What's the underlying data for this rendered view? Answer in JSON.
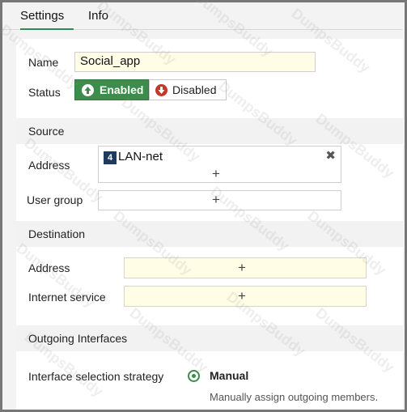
{
  "tabs": [
    {
      "label": "Settings",
      "active": true
    },
    {
      "label": "Info",
      "active": false
    }
  ],
  "form": {
    "name_label": "Name",
    "name_value": "Social_app",
    "status_label": "Status",
    "status_enabled": "Enabled",
    "status_disabled": "Disabled",
    "status_selected": "Enabled"
  },
  "source": {
    "title": "Source",
    "address_label": "Address",
    "address_entries": [
      {
        "badge": "4",
        "name": "LAN-net"
      }
    ],
    "user_group_label": "User group"
  },
  "destination": {
    "title": "Destination",
    "address_label": "Address",
    "internet_service_label": "Internet service"
  },
  "outgoing": {
    "title": "Outgoing Interfaces",
    "strategy_label": "Interface selection strategy",
    "option_label": "Manual",
    "option_hint": "Manually assign outgoing members."
  },
  "icons": {
    "add": "+",
    "remove": "✖"
  },
  "watermark_text": "DumpsBuddy",
  "colors": {
    "accent_green": "#3c8c4c",
    "disabled_red": "#c0392b",
    "required_field_bg": "#fffde6",
    "badge_navy": "#1e3a5f"
  }
}
